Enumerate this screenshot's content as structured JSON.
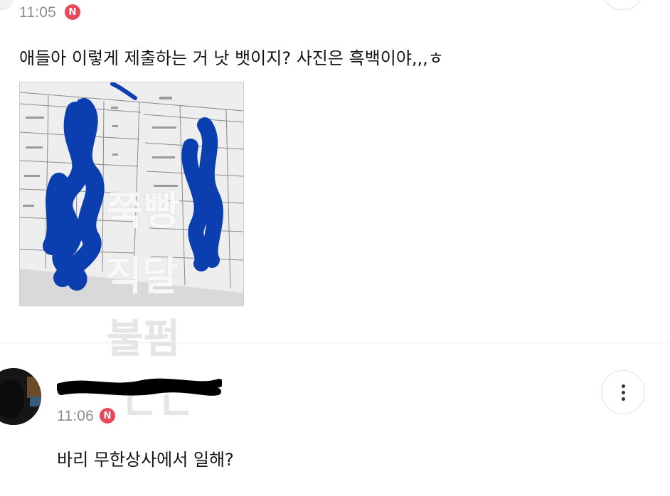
{
  "post": {
    "time": "11:05",
    "badge": "N",
    "text": "애들아 이렇게 제출하는 거 낫 뱃이지? 사진은 흑백이야,,,ㅎ"
  },
  "watermark": {
    "lines": [
      "쭉빵",
      "직달",
      "불펌",
      "ㄴㄴ"
    ]
  },
  "comment": {
    "time": "11:06",
    "badge": "N",
    "text": "바리 무한상사에서 일해?"
  },
  "colors": {
    "badge": "#e8475a",
    "time": "#8c8c8c",
    "scribble": "#0b3fb0"
  },
  "icons": {
    "more": "more-vertical-icon"
  }
}
